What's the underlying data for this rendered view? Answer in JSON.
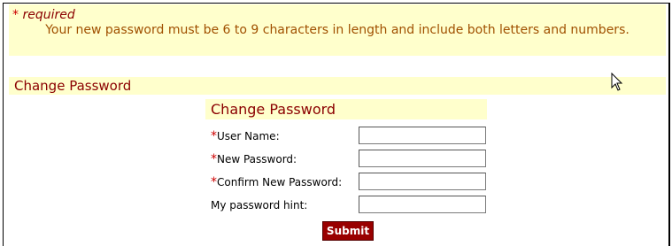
{
  "notice": {
    "required_star": "*",
    "required_label": " required",
    "rule_text": "Your new password must be 6 to 9 characters in length and include both letters and numbers."
  },
  "section": {
    "title": "Change Password"
  },
  "form": {
    "title": "Change Password",
    "fields": [
      {
        "star": "*",
        "label": "User Name:",
        "value": ""
      },
      {
        "star": "*",
        "label": "New Password:",
        "value": ""
      },
      {
        "star": "*",
        "label": "Confirm New Password:",
        "value": ""
      },
      {
        "star": "",
        "label": "My password hint:",
        "value": ""
      }
    ],
    "submit_label": "Submit"
  },
  "colors": {
    "highlight_bg": "#ffffcc",
    "heading": "#8b0000",
    "required_star": "#cc0000",
    "submit_bg": "#990000"
  },
  "icons": {
    "cursor": "mouse-pointer-icon"
  }
}
